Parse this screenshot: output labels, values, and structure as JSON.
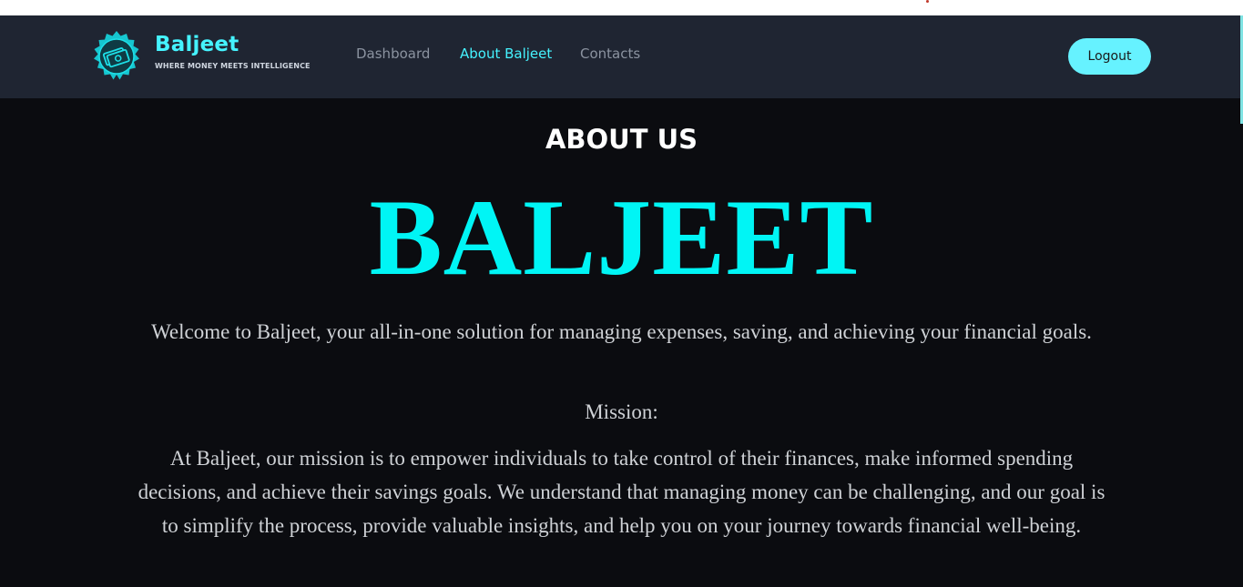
{
  "brand": {
    "name": "Baljeet",
    "tagline": "WHERE MONEY MEETS INTELLIGENCE",
    "accent_color": "#45f3ff"
  },
  "nav": {
    "items": [
      {
        "label": "Dashboard",
        "active": false
      },
      {
        "label": "About Baljeet",
        "active": true
      },
      {
        "label": "Contacts",
        "active": false
      }
    ],
    "logout_label": "Logout"
  },
  "main": {
    "heading": "ABOUT US",
    "title": "BALJEET",
    "welcome": "Welcome to Baljeet, your all-in-one solution for managing expenses, saving, and achieving your financial goals.",
    "mission_label": "Mission:",
    "mission_text": "At Baljeet, our mission is to empower individuals to take control of their finances, make informed spending decisions, and achieve their savings goals. We understand that managing money can be challenging, and our goal is to simplify the process, provide valuable insights, and help you on your journey towards financial well-being."
  }
}
